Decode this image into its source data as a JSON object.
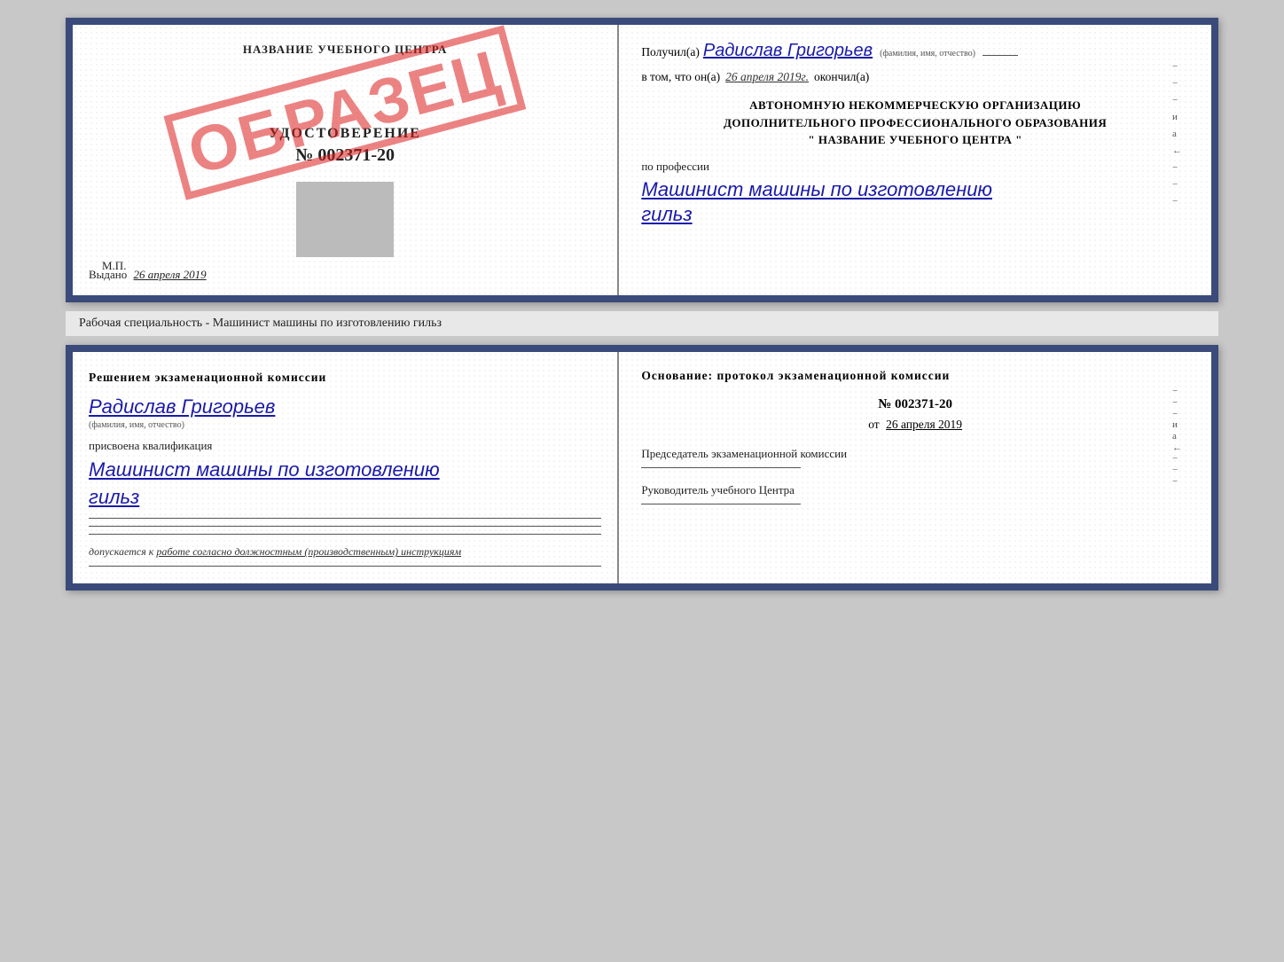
{
  "top_doc": {
    "left": {
      "school_name": "НАЗВАНИЕ УЧЕБНОГО ЦЕНТРА",
      "stamp_text": "ОБРАЗЕЦ",
      "cert_label": "УДОСТОВЕРЕНИЕ",
      "cert_number": "№ 002371-20",
      "issued_label": "Выдано",
      "issued_date": "26 апреля 2019",
      "mp_label": "М.П."
    },
    "right": {
      "received_prefix": "Получил(а)",
      "recipient_name": "Радислав Григорьев",
      "fio_subtitle": "(фамилия, имя, отчество)",
      "in_that_prefix": "в том, что он(а)",
      "completed_date": "26 апреля 2019г.",
      "completed_suffix": "окончил(а)",
      "org_line1": "АВТОНОМНУЮ НЕКОММЕРЧЕСКУЮ ОРГАНИЗАЦИЮ",
      "org_line2": "ДОПОЛНИТЕЛЬНОГО ПРОФЕССИОНАЛЬНОГО ОБРАЗОВАНИЯ",
      "org_line3": "\" НАЗВАНИЕ УЧЕБНОГО ЦЕНТРА \"",
      "profession_label": "по профессии",
      "profession_name": "Машинист машины по изготовлению",
      "profession_name2": "гильз",
      "side_dashes": [
        "-",
        "-",
        "-",
        "и",
        "а",
        "←",
        "-",
        "-",
        "-"
      ]
    }
  },
  "middle_label": "Рабочая специальность - Машинист машины по изготовлению гильз",
  "bottom_doc": {
    "left": {
      "decision_text": "Решением  экзаменационной  комиссии",
      "person_name": "Радислав Григорьев",
      "fio_subtitle": "(фамилия, имя, отчество)",
      "assigned_text": "присвоена квалификация",
      "qualification_line1": "Машинист машины по изготовлению",
      "qualification_line2": "гильз",
      "allowed_prefix": "допускается к",
      "allowed_text": "работе согласно должностным (производственным) инструкциям"
    },
    "right": {
      "basis_text": "Основание:  протокол  экзаменационной  комиссии",
      "protocol_number": "№  002371-20",
      "date_prefix": "от",
      "protocol_date": "26 апреля 2019",
      "chair_label": "Председатель экзаменационной комиссии",
      "head_label": "Руководитель учебного Центра",
      "side_dashes": [
        "-",
        "-",
        "-",
        "и",
        "а",
        "←",
        "-",
        "-",
        "-"
      ]
    }
  }
}
